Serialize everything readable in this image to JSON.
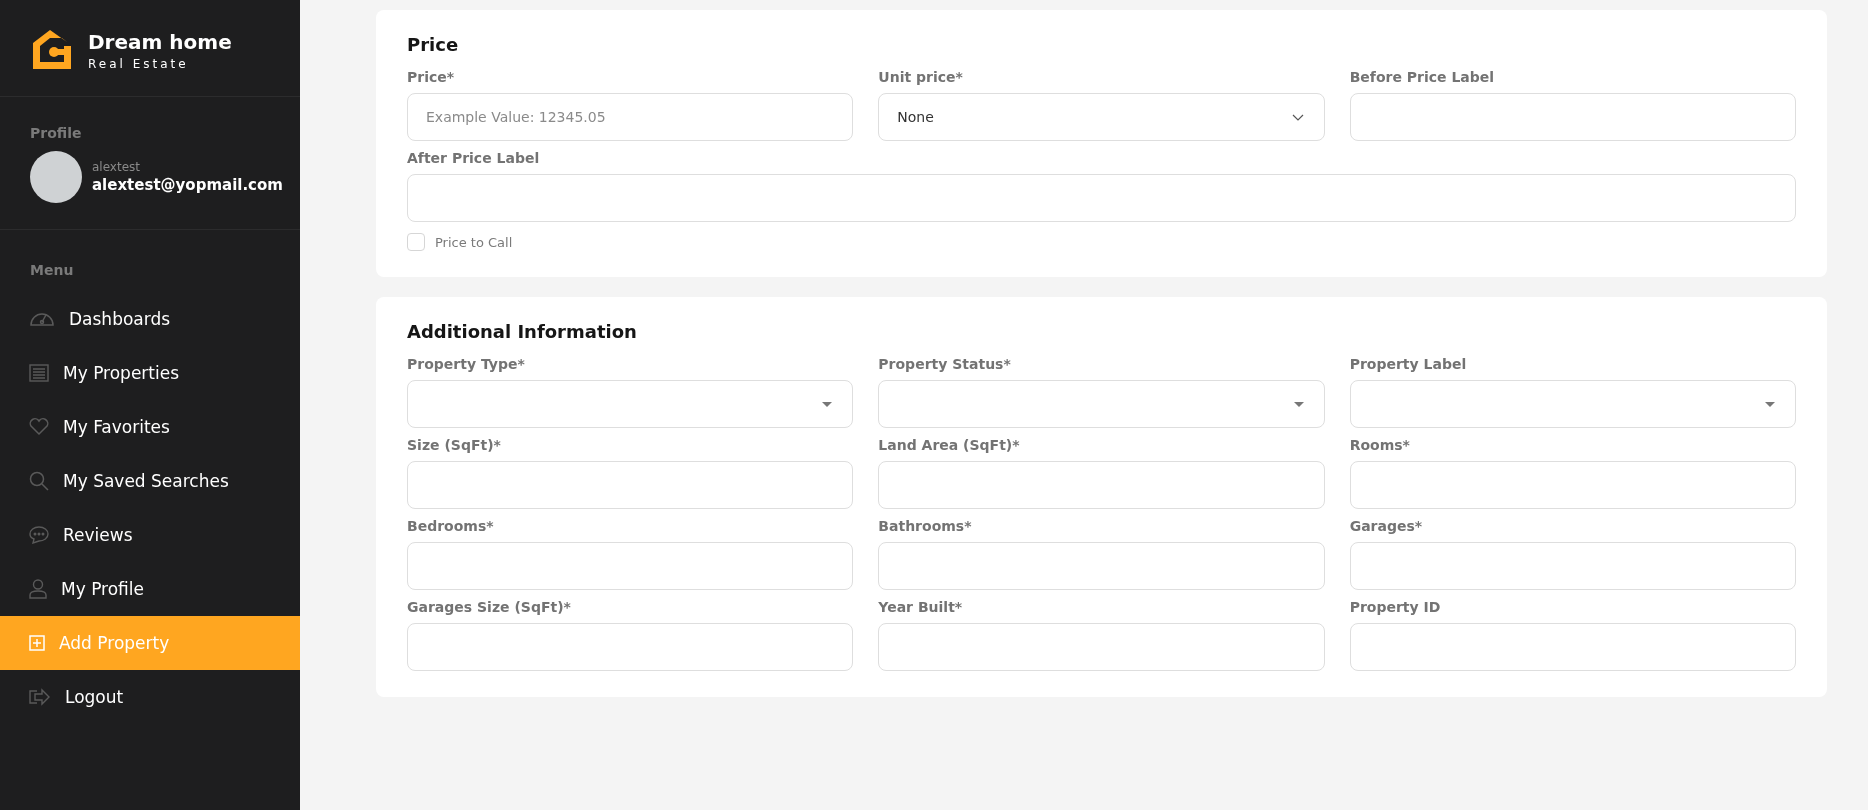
{
  "sidebar": {
    "brand": {
      "title": "Dream home",
      "subtitle": "Real Estate"
    },
    "profile": {
      "heading": "Profile",
      "username": "alextest",
      "email": "alextest@yopmail.com"
    },
    "menu_heading": "Menu",
    "items": [
      {
        "label": "Dashboards",
        "selected": false
      },
      {
        "label": "My Properties",
        "selected": false
      },
      {
        "label": "My Favorites",
        "selected": false
      },
      {
        "label": "My Saved Searches",
        "selected": false
      },
      {
        "label": "Reviews",
        "selected": false
      },
      {
        "label": "My Profile",
        "selected": false
      },
      {
        "label": "Add Property",
        "selected": true
      },
      {
        "label": "Logout",
        "selected": false
      }
    ]
  },
  "sections": [
    {
      "title": "Price",
      "fields": [
        {
          "kind": "input",
          "label": "Price*",
          "placeholder": "Example Value: 12345.05"
        },
        {
          "kind": "select",
          "label": "Unit price*",
          "value": "None"
        },
        {
          "kind": "input",
          "label": "Before Price Label"
        },
        {
          "kind": "wide-input",
          "label": "After Price Label"
        },
        {
          "kind": "checkbox",
          "label": "Price to Call",
          "checked": false
        }
      ]
    },
    {
      "title": "Additional Information",
      "fields": [
        {
          "kind": "dropdown",
          "label": "Property Type*"
        },
        {
          "kind": "dropdown",
          "label": "Property Status*"
        },
        {
          "kind": "dropdown",
          "label": "Property Label"
        },
        {
          "kind": "input",
          "label": "Size (SqFt)*"
        },
        {
          "kind": "input",
          "label": "Land Area (SqFt)*"
        },
        {
          "kind": "input",
          "label": "Rooms*"
        },
        {
          "kind": "input",
          "label": "Bedrooms*"
        },
        {
          "kind": "input",
          "label": "Bathrooms*"
        },
        {
          "kind": "input",
          "label": "Garages*"
        },
        {
          "kind": "input",
          "label": "Garages Size (SqFt)*"
        },
        {
          "kind": "input",
          "label": "Year Built*"
        },
        {
          "kind": "input",
          "label": "Property ID"
        }
      ]
    }
  ]
}
